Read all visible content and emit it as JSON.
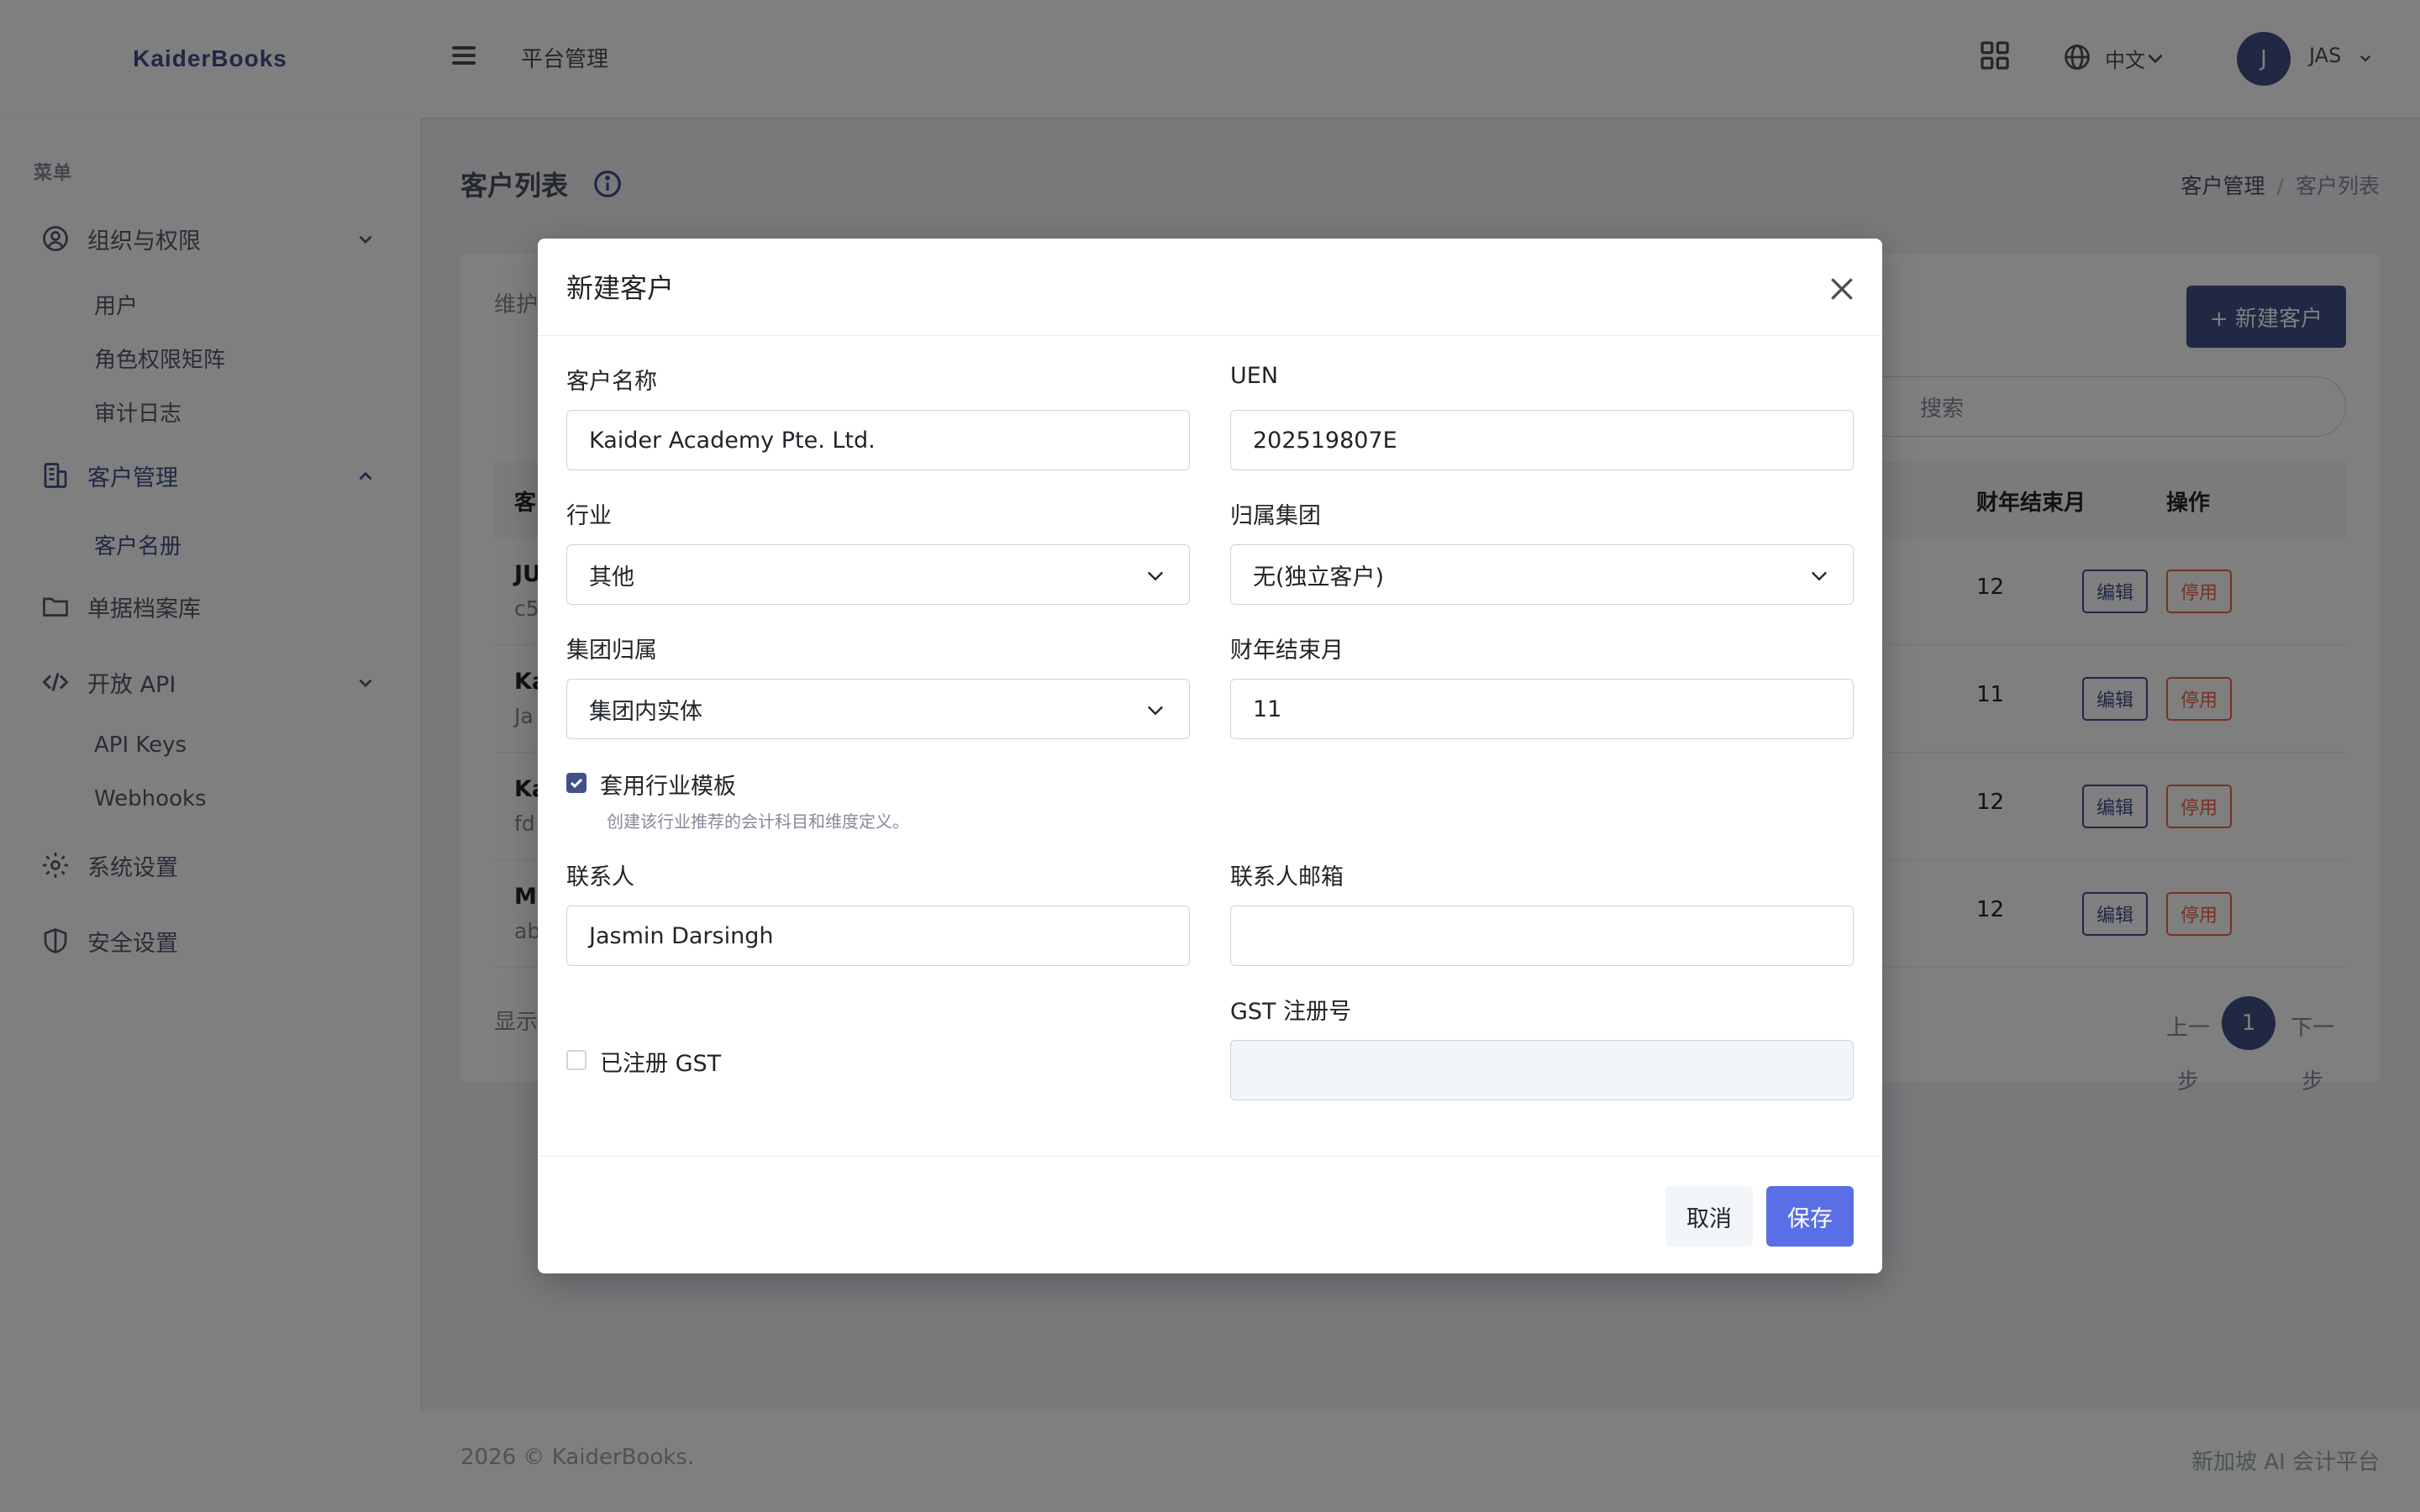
{
  "app": {
    "brand": "KaiderBooks",
    "top_title": "平台管理",
    "lang": "中文",
    "user_initial": "J",
    "user_name": "JAS",
    "accent": "#405189"
  },
  "sidebar": {
    "menu_title": "菜单",
    "groups": [
      {
        "label": "组织与权限",
        "icon": "user-circle-icon"
      },
      {
        "label": "客户管理",
        "icon": "building-icon"
      },
      {
        "label": "单据档案库",
        "icon": "folder-icon"
      },
      {
        "label": "开放 API",
        "icon": "code-icon"
      },
      {
        "label": "系统设置",
        "icon": "gear-icon"
      },
      {
        "label": "安全设置",
        "icon": "shield-icon"
      }
    ],
    "org_items": [
      "用户",
      "角色权限矩阵",
      "审计日志"
    ],
    "client_items": [
      "客户名册"
    ],
    "api_items": [
      "API Keys",
      "Webhooks"
    ]
  },
  "page": {
    "title": "客户列表",
    "breadcrumb": [
      "客户管理",
      "客户列表"
    ],
    "card_desc": "维护",
    "new_button": "+ 新建客户",
    "search_placeholder": "搜索",
    "table": {
      "headers": [
        "客",
        "财年结束月",
        "操作"
      ],
      "rows": [
        {
          "name": "JU",
          "sub": "c5",
          "fy": "12"
        },
        {
          "name": "Ka",
          "sub": "Ja",
          "fy": "11"
        },
        {
          "name": "Ka",
          "sub": "fd",
          "fy": "12"
        },
        {
          "name": "Mo",
          "sub": "ab",
          "fy": "12"
        }
      ],
      "edit_label": "编辑",
      "disable_label": "停用"
    },
    "showing": "显示",
    "pagination": {
      "prev": "上一步",
      "current": "1",
      "next": "下一步"
    }
  },
  "footer": {
    "left": "2026 © KaiderBooks.",
    "right": "新加坡 AI 会计平台"
  },
  "modal": {
    "title": "新建客户",
    "fields": {
      "client_name": {
        "label": "客户名称",
        "value": "Kaider Academy Pte. Ltd."
      },
      "uen": {
        "label": "UEN",
        "value": "202519807E"
      },
      "industry": {
        "label": "行业",
        "value": "其他"
      },
      "parent_group": {
        "label": "归属集团",
        "value": "无(独立客户)"
      },
      "group_role": {
        "label": "集团归属",
        "value": "集团内实体"
      },
      "fy_end": {
        "label": "财年结束月",
        "value": "11"
      },
      "apply_template": {
        "label": "套用行业模板",
        "hint": "创建该行业推荐的会计科目和维度定义。",
        "checked": true
      },
      "contact": {
        "label": "联系人",
        "value": "Jasmin Darsingh"
      },
      "contact_email": {
        "label": "联系人邮箱",
        "value": ""
      },
      "gst_registered": {
        "label": "已注册 GST",
        "checked": false
      },
      "gst_no": {
        "label": "GST 注册号",
        "value": ""
      }
    },
    "cancel": "取消",
    "save": "保存"
  }
}
